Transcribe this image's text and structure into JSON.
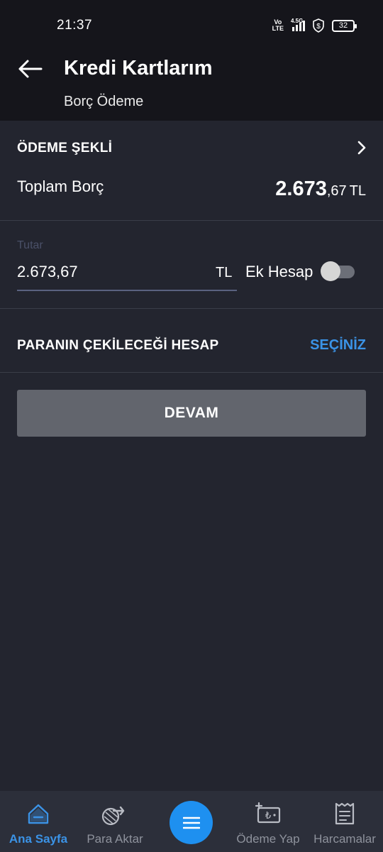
{
  "status_bar": {
    "time": "21:37",
    "volte_line1": "Vo",
    "volte_line2": "LTE",
    "network": "4.5G",
    "battery": "32"
  },
  "header": {
    "title": "Kredi Kartlarım",
    "subtitle": "Borç Ödeme"
  },
  "payment_method": {
    "label": "ÖDEME ŞEKLİ"
  },
  "total_debt": {
    "label": "Toplam Borç",
    "amount_integer": "2.673",
    "amount_decimal": ",67",
    "currency": "TL"
  },
  "amount_field": {
    "label": "Tutar",
    "value": "2.673,67",
    "currency": "TL"
  },
  "extra_account": {
    "label": "Ek Hesap",
    "enabled": false
  },
  "source_account": {
    "label": "PARANIN ÇEKİLECEĞİ HESAP",
    "action": "SEÇİNİZ"
  },
  "continue_button": {
    "label": "DEVAM"
  },
  "bottom_nav": {
    "items": [
      {
        "label": "Ana Sayfa",
        "icon": "home-icon",
        "active": true
      },
      {
        "label": "Para Aktar",
        "icon": "transfer-icon",
        "active": false
      },
      {
        "label": "",
        "icon": "menu-icon",
        "active": false
      },
      {
        "label": "Ödeme Yap",
        "icon": "payment-icon",
        "active": false
      },
      {
        "label": "Harcamalar",
        "icon": "receipt-icon",
        "active": false
      }
    ]
  },
  "colors": {
    "background": "#23252f",
    "header": "#15151b",
    "accent": "#3b93e6",
    "fab": "#1e90f0",
    "button_disabled": "#62656d"
  }
}
